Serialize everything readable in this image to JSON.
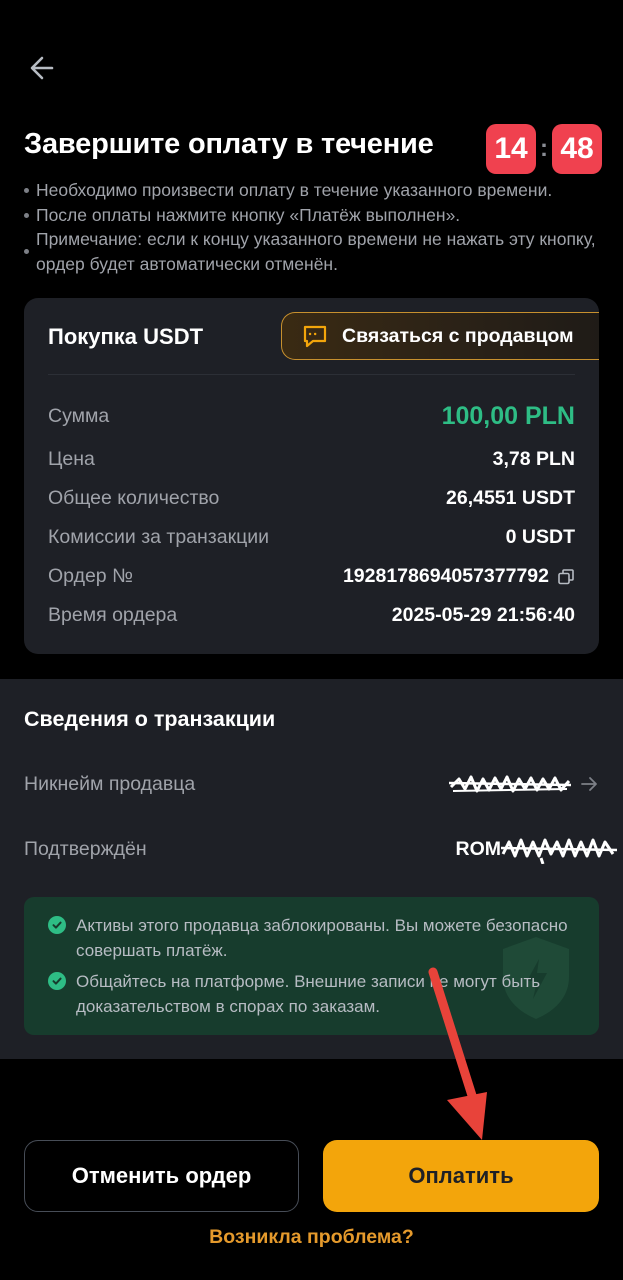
{
  "header": {
    "back_icon": "arrow-left-icon",
    "title": "Завершите оплату в течение",
    "timer": {
      "minutes": "14",
      "separator": ":",
      "seconds": "48"
    }
  },
  "notes": [
    "Необходимо произвести оплату в течение указанного времени.",
    "После оплаты нажмите кнопку «Платёж выполнен».",
    "Примечание: если к концу указанного времени не нажать эту кнопку, ордер будет автоматически отменён."
  ],
  "order_card": {
    "title": "Покупка USDT",
    "contact_label": "Связаться с продавцом",
    "contact_icon": "chat-icon",
    "rows": [
      {
        "label": "Сумма",
        "value": "100,00 PLN"
      },
      {
        "label": "Цена",
        "value": "3,78 PLN"
      },
      {
        "label": "Общее количество",
        "value": "26,4551 USDT"
      },
      {
        "label": "Комиссии за транзакции",
        "value": "0 USDT"
      },
      {
        "label": "Ордер №",
        "value": "1928178694057377792"
      },
      {
        "label": "Время ордера",
        "value": "2025-05-29 21:56:40"
      }
    ],
    "copy_icon": "copy-icon",
    "amount_color": "#2ebd85"
  },
  "transaction": {
    "title": "Сведения о транзакции",
    "seller_label": "Никнейм продавца",
    "confirmed_label": "Подтверждён",
    "confirmed_value_prefix": "ROM",
    "chevron_icon": "chevron-right-icon",
    "info_lines": [
      "Активы этого продавца заблокированы. Вы можете безопасно совершать платёж.",
      "Общайтесь на платформе. Внешние записи не могут быть доказательством в спорах по заказам."
    ]
  },
  "footer": {
    "cancel_label": "Отменить ордер",
    "pay_label": "Оплатить",
    "problem_label": "Возникла проблема?"
  },
  "colors": {
    "accent": "#f3a50b",
    "timer": "#f0414f",
    "green": "#2ebd85",
    "link": "#e59a2c",
    "annotation_arrow": "#e8433a"
  }
}
